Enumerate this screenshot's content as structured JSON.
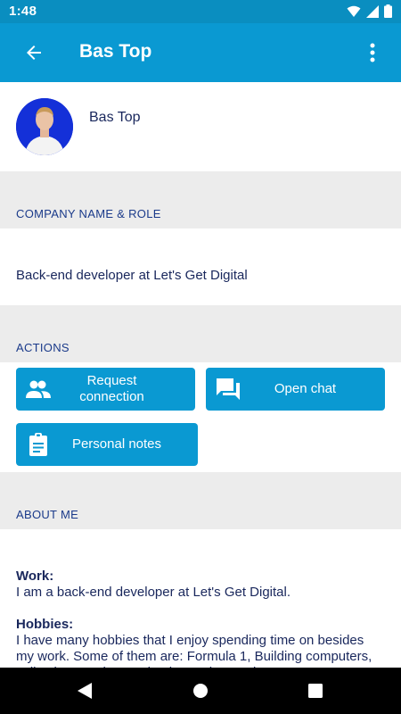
{
  "status_bar": {
    "time": "1:48"
  },
  "app_bar": {
    "title": "Bas Top"
  },
  "profile": {
    "name": "Bas Top"
  },
  "sections": {
    "company_header": "COMPANY NAME & ROLE",
    "company_value": "Back-end developer at Let's Get Digital",
    "actions_header": "ACTIONS",
    "about_header": "ABOUT ME"
  },
  "actions": {
    "request_connection": "Request connection",
    "open_chat": "Open chat",
    "personal_notes": "Personal notes"
  },
  "about": {
    "work_heading": "Work:",
    "work_text": "I am a back-end developer at Let's Get Digital.",
    "hobbies_heading": "Hobbies:",
    "hobbies_text": "I have many hobbies that I enjoy spending time on besides my work. Some of them are: Formula 1, Building computers, collecting watches and going to the movies."
  },
  "colors": {
    "app_bar": "#0a99d2",
    "status_bar": "#0a8ec0",
    "button": "#0a99d2",
    "section_bg": "#ececec",
    "text": "#19275c"
  },
  "icons": {
    "back": "arrow-left-icon",
    "more": "more-vert-icon",
    "request_connection": "people-icon",
    "open_chat": "chat-icon",
    "personal_notes": "clipboard-icon"
  }
}
